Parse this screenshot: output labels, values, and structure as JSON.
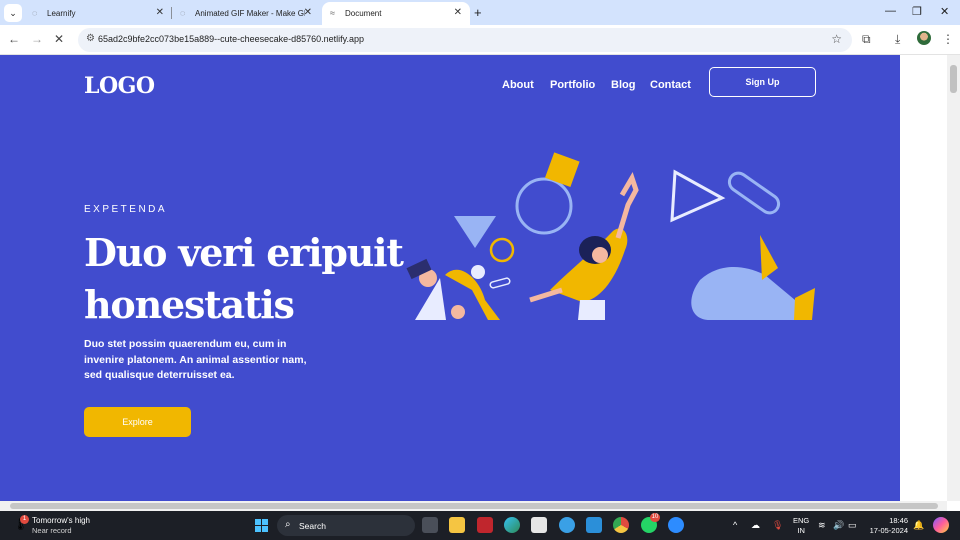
{
  "browser": {
    "tabs": [
      {
        "title": "Learnify",
        "active": false
      },
      {
        "title": "Animated GIF Maker - Make GIFs",
        "active": false
      },
      {
        "title": "Document",
        "active": true
      }
    ],
    "url": "65ad2c9bfe2cc073be15a889--cute-cheesecake-d85760.netlify.app"
  },
  "site": {
    "logo": "LOGO",
    "nav": [
      "About",
      "Portfolio",
      "Blog",
      "Contact"
    ],
    "signup_label": "Sign Up",
    "eyebrow": "EXPETENDA",
    "headline": "Duo veri eripuit honestatis",
    "lead": "Duo stet possim quaerendum eu, cum in invenire platonem. An animal assentior nam, sed qualisque deterruisset ea.",
    "cta_label": "Explore",
    "colors": {
      "background": "#414cce",
      "accent": "#f1b700",
      "shape_light": "#99b4f4",
      "text": "#ffffff"
    }
  },
  "taskbar": {
    "weather_title": "Tomorrow's high",
    "weather_sub": "Near record",
    "weather_badge": "1",
    "search_label": "Search",
    "apps": [
      "file-explorer-icon",
      "folder-icon",
      "mcafee-icon",
      "edge-icon",
      "store-icon",
      "vpn-icon",
      "vscode-icon",
      "chrome-icon",
      "whatsapp-icon",
      "zoom-icon"
    ],
    "whatsapp_badge": "10",
    "lang_line1": "ENG",
    "lang_line2": "IN",
    "time": "18:46",
    "date": "17-05-2024"
  }
}
